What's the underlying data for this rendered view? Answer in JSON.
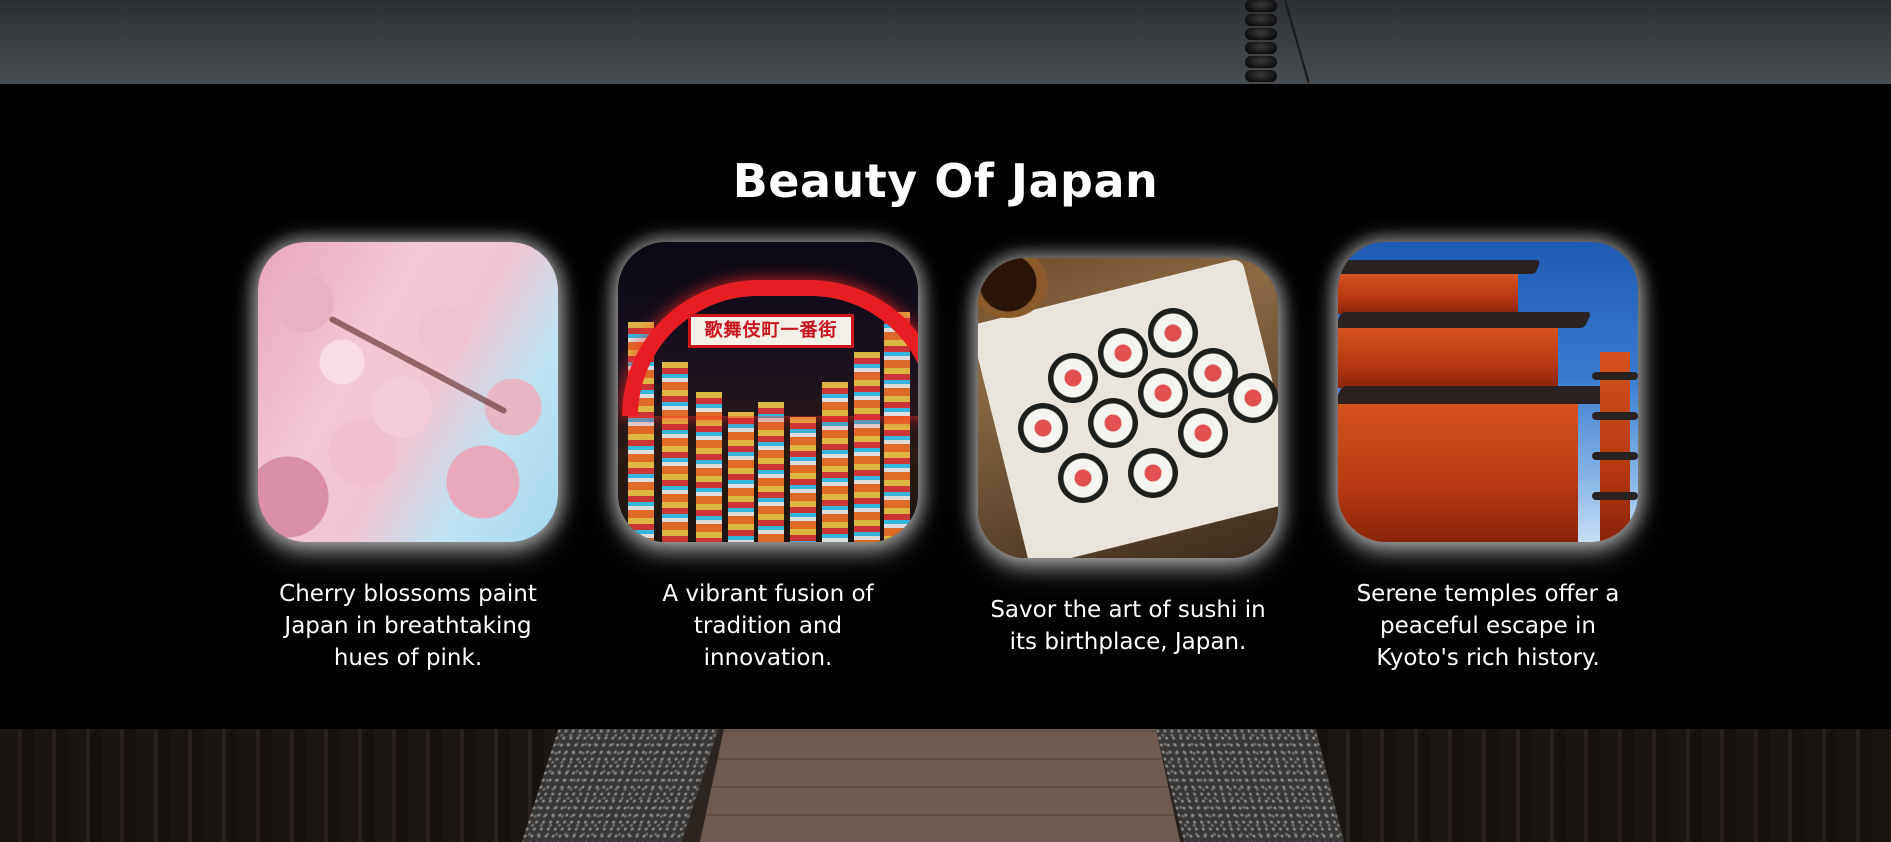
{
  "section": {
    "title": "Beauty Of Japan"
  },
  "cards": [
    {
      "image_alt": "Cherry blossoms",
      "caption": "Cherry blossoms paint Japan in breathtaking hues of pink."
    },
    {
      "image_alt": "Kabukicho street at night",
      "caption": "A vibrant fusion of tradition and innovation.",
      "sign_text": "歌舞伎町一番街"
    },
    {
      "image_alt": "Sushi rolls on a plate",
      "caption": "Savor the art of sushi in its birthplace, Japan."
    },
    {
      "image_alt": "Japanese temple",
      "caption": "Serene temples offer a peaceful escape in Kyoto's rich history."
    }
  ],
  "colors": {
    "panel_background": "#000000",
    "text": "#ffffff",
    "photo_glow": "#ffffff"
  }
}
